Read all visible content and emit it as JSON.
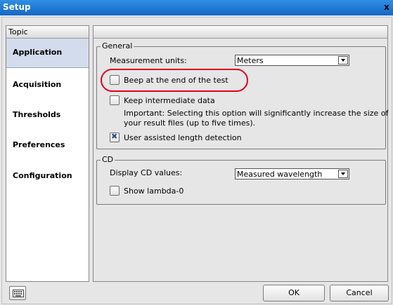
{
  "window": {
    "title": "Setup",
    "close_glyph": "x"
  },
  "topic": {
    "header": "Topic",
    "items": [
      {
        "label": "Application",
        "selected": true
      },
      {
        "label": "Acquisition",
        "selected": false
      },
      {
        "label": "Thresholds",
        "selected": false
      },
      {
        "label": "Preferences",
        "selected": false
      },
      {
        "label": "Configuration",
        "selected": false
      }
    ]
  },
  "general": {
    "legend": "General",
    "measurement_units_label": "Measurement units:",
    "measurement_units_value": "Meters",
    "beep_label": "Beep at the end of the test",
    "beep_checked": false,
    "keep_label": "Keep intermediate data",
    "keep_checked": false,
    "important_line1": "Important: Selecting this option will significantly increase the size of",
    "important_line2": "your result files (up to five times).",
    "user_assisted_label": "User assisted length detection",
    "user_assisted_checked": true
  },
  "cd": {
    "legend": "CD",
    "display_label": "Display CD values:",
    "display_value": "Measured wavelength",
    "lambda_label": "Show lambda-0",
    "lambda_checked": false
  },
  "buttons": {
    "ok": "OK",
    "cancel": "Cancel"
  },
  "icons": {
    "keyboard": "keyboard-icon",
    "close": "close-icon"
  },
  "colors": {
    "title_bar": "#1f78d6",
    "selected_topic": "#d3dcec",
    "highlight": "#e0001b"
  }
}
